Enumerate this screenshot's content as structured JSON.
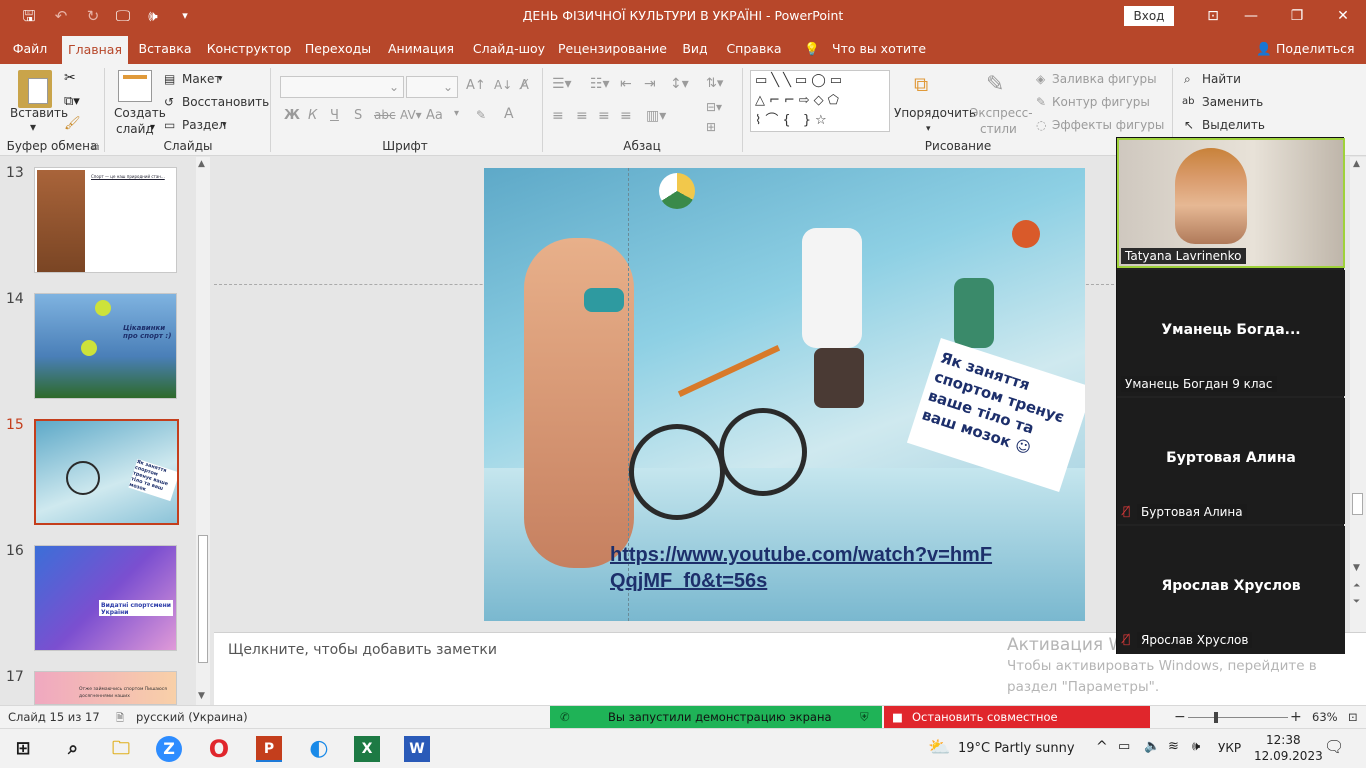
{
  "title": {
    "app_title": "ДЕНЬ ФІЗИЧНОЇ КУЛЬТУРИ В УКРАЇНІ  -  PowerPoint",
    "signin": "Вход",
    "accent": "#b7472a"
  },
  "qa": {
    "save": "🖫",
    "undo": "↶",
    "redo": "↻",
    "present": "🖵",
    "audio": "🕪",
    "more": "▾"
  },
  "window": {
    "minimize": "—",
    "restore": "❐",
    "close": "✕"
  },
  "tabs": [
    "Файл",
    "Главная",
    "Вставка",
    "Конструктор",
    "Переходы",
    "Анимация",
    "Слайд-шоу",
    "Рецензирование",
    "Вид",
    "Справка"
  ],
  "tellme": "Что вы хотите сделать?",
  "share": "Поделиться",
  "ribbon": {
    "paste": "Вставить",
    "clipboard_group": "Буфер обмена",
    "new_slide": "Создать",
    "new_slide2": "слайд",
    "layout": "Макет",
    "reset": "Восстановить",
    "section": "Раздел",
    "slides_group": "Слайды",
    "bold": "Ж",
    "italic": "К",
    "underline": "Ч",
    "strike": "S",
    "font_group": "Шрифт",
    "fontcase": "Aa",
    "fontcolor": "A",
    "paragraph_group": "Абзац",
    "arrange": "Упорядочить",
    "quick_styles": "Экспресс-",
    "quick_styles2": "стили",
    "shape_fill": "Заливка фигуры",
    "shape_outline": "Контур фигуры",
    "shape_effects": "Эффекты фигуры",
    "drawing_group": "Рисование",
    "find": "Найти",
    "replace": "Заменить",
    "select": "Выделить"
  },
  "thumbs": [
    {
      "num": "13",
      "text": "Спорт — це наш природний стан...",
      "active": false
    },
    {
      "num": "14",
      "text": "Цікавинки про спорт :)",
      "active": false
    },
    {
      "num": "15",
      "text": "Як заняття спортом тренує ваше тіло та ваш мозок",
      "active": true
    },
    {
      "num": "16",
      "text": "Видатні спортсмени України",
      "active": false
    },
    {
      "num": "17",
      "text": "Отже займаючись спортом Пишаюся досягненнями наших",
      "active": false
    }
  ],
  "slide": {
    "caption": "Як заняття спортом тренує ваше тіло та ваш мозок ☺",
    "link_line1": "https://www.youtube.com/watch?v=hmF",
    "link_line2": "QqjMF_f0&t=56s"
  },
  "notes_placeholder": "Щелкните, чтобы добавить заметки",
  "activation": {
    "title": "Активация Windows",
    "text1": "Чтобы активировать Windows, перейдите в",
    "text2": "раздел \"Параметры\"."
  },
  "participants": [
    {
      "name": "Tatyana Lavrinenko",
      "label": "Tatyana Lavrinenko",
      "video": true
    },
    {
      "name": "Уманець  Богда...",
      "label": "Уманець Богдан 9 клас",
      "muted": false
    },
    {
      "name": "Буртовая Алина",
      "label": "Буртовая Алина",
      "muted": true
    },
    {
      "name": "Ярослав Хруслов",
      "label": "Ярослав Хруслов",
      "muted": true
    }
  ],
  "status": {
    "slide_info": "Слайд 15 из 17",
    "language": "русский (Украина)",
    "share_msg": "Вы запустили демонстрацию экрана",
    "stop_share": "Остановить совместное использование",
    "zoom": "63%",
    "zoom_minus": "−",
    "zoom_plus": "+"
  },
  "taskbar": {
    "weather": "19°C  Partly sunny",
    "lang": "УКР",
    "time": "12:38",
    "date": "12.09.2023"
  }
}
